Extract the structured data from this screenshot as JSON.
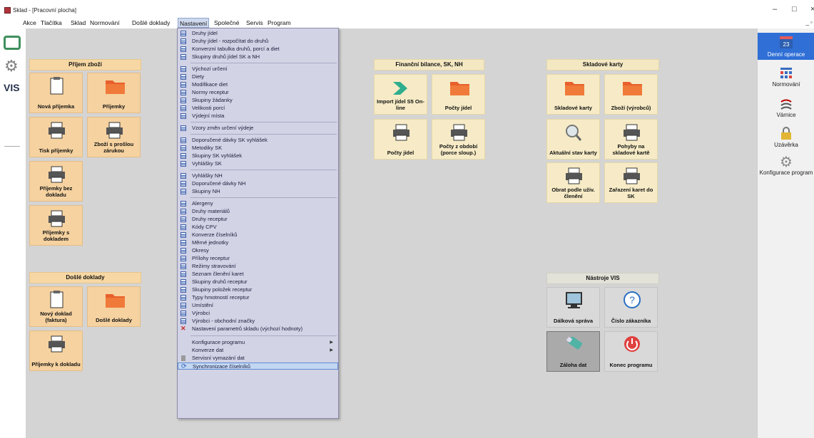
{
  "window": {
    "title": "Sklad - [Pracovní plocha]",
    "minimize": "–",
    "maximize": "□",
    "close": "×",
    "mdi_restore": "_ ▫"
  },
  "menubar": [
    "Akce",
    "Tlačítka",
    "Sklad",
    "Normování",
    "Došlé doklady",
    "Nastavení",
    "Společné",
    "Servis",
    "Program"
  ],
  "leftbar": {
    "logo_text": "VIS"
  },
  "groups": {
    "prijem": {
      "title": "Příjem zboží",
      "tiles": [
        "Nová příjemka",
        "Příjemky",
        "Tisk příjemky",
        "Zboží s prošlou zárukou",
        "Příjemky bez dokladu",
        "Příjemky s dokladem"
      ]
    },
    "dosle": {
      "title": "Došlé doklady",
      "tiles": [
        "Nový doklad (faktura)",
        "Došlé doklady",
        "Příjemky k dokladu"
      ]
    },
    "financni": {
      "title": "Finanční bilance, SK, NH",
      "tiles": [
        "Import jídel S5 On-line",
        "Počty jídel",
        "Počty jídel",
        "Počty z období (porce sloup.)"
      ]
    },
    "skladove": {
      "title": "Skladové karty",
      "tiles": [
        "Skladové karty",
        "Zboží (výrobců)",
        "Aktuální stav karty",
        "Pohyby na skladové kartě",
        "Obrat podle uživ. členění",
        "Zařazení karet do SK"
      ]
    },
    "nastroje": {
      "title": "Nástroje VIS",
      "tiles": [
        "Dálková správa",
        "Číslo zákazníka",
        "Záloha dat",
        "Konec programu"
      ]
    }
  },
  "dropdown": {
    "items": [
      "Druhy jídel",
      "Druhy jídel - rozpočítat do druhů",
      "Konverzní tabulka druhů, porcí a diet",
      "Skupiny druhů jídel SK a NH",
      "Výchozí určení",
      "Diety",
      "Modifikace diet",
      "Normy receptur",
      "Skupiny žádanky",
      "Velikosti porcí",
      "Výdejní místa",
      "Vzory změn určení výdeje",
      "Doporučené dávky SK vyhlášek",
      "Metodiky SK",
      "Skupiny SK vyhlášek",
      "Vyhlášky SK",
      "Vyhlášky NH",
      "Doporučené dávky NH",
      "Skupiny NH",
      "Alergeny",
      "Druhy materiálů",
      "Druhy receptur",
      "Kódy CPV",
      "Konverze číselníků",
      "Měrné jednotky",
      "Okresy",
      "Přílohy receptur",
      "Režimy stravování",
      "Seznam členění karet",
      "Skupiny druhů receptur",
      "Skupiny položek receptur",
      "Typy hmotností receptur",
      "Umístění",
      "Výrobci",
      "Výrobci - obchodní značky",
      "Nastavení parametrů skladu (výchozí hodnoty)",
      "Konfigurace programu",
      "Konverze dat",
      "Servisní vymazání dat",
      "Synchronizace číselníků"
    ]
  },
  "rightbar": [
    "Denní operace",
    "Normování",
    "Várnice",
    "Uzávěrka",
    "Konfigurace program"
  ],
  "colors": {
    "tile": "#f5d2a0",
    "tile_light": "#f6ebc6",
    "workspace": "#d4d4d4",
    "menu": "#d3d3e6",
    "selected": "#2f6fd6"
  }
}
